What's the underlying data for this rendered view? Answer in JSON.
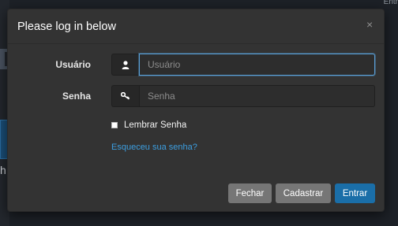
{
  "background": {
    "top_right_text": "Entr",
    "left_fragment_text": "h"
  },
  "modal": {
    "title": "Please log in below",
    "close_glyph": "×"
  },
  "form": {
    "username": {
      "label": "Usuário",
      "placeholder": "Usuário",
      "value": "",
      "icon": "user-icon"
    },
    "password": {
      "label": "Senha",
      "placeholder": "Senha",
      "value": "",
      "icon": "key-icon"
    },
    "remember_label": "Lembrar Senha",
    "remember_checked": false,
    "forgot_link": "Esqueceu sua senha?"
  },
  "buttons": {
    "close": "Fechar",
    "register": "Cadastrar",
    "login": "Entrar"
  },
  "colors": {
    "modal_bg": "#333333",
    "primary": "#1a6ea8",
    "link": "#3c9ee0",
    "secondary_button": "#767676"
  }
}
